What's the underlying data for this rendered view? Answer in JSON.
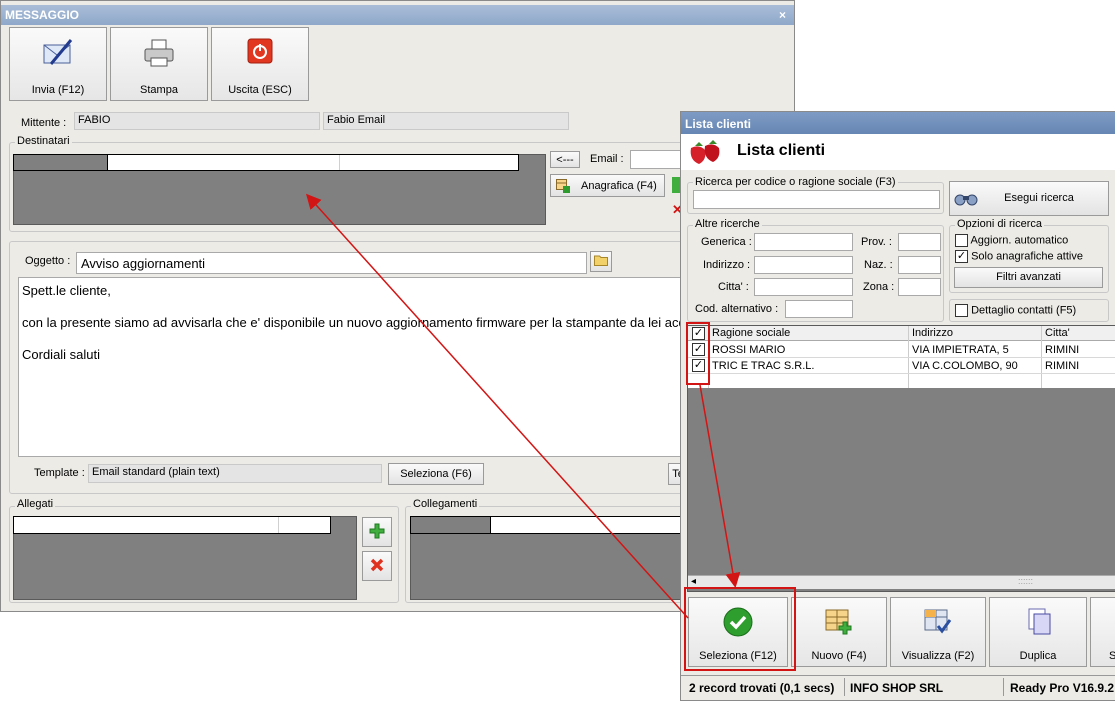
{
  "messaggio": {
    "title": "MESSAGGIO",
    "close": "×",
    "toolbar": {
      "invia": "Invia (F12)",
      "stampa": "Stampa",
      "uscita": "Uscita (ESC)"
    },
    "mittente_label": "Mittente :",
    "mittente_value": "FABIO",
    "mittente_email": "Fabio Email",
    "destinatari_label": "Destinatari",
    "arrow_btn": "<---",
    "email_label": "Email :",
    "anagrafica_btn": "Anagrafica (F4)",
    "oggetto_label": "Oggetto :",
    "oggetto_value": "Avviso aggiornamenti",
    "body_lines": [
      "Spett.le cliente,",
      "con la presente siamo ad avvisarla che e' disponibile un nuovo aggiornamento firmware per la stampante da lei acq",
      "Cordiali saluti"
    ],
    "template_label": "Template :",
    "template_value": "Email standard (plain text)",
    "seleziona_btn": "Seleziona (F6)",
    "te_btn": "Te",
    "allegati_label": "Allegati",
    "collegamenti_label": "Collegamenti"
  },
  "lista": {
    "window_title": "Lista clienti",
    "header_title": "Lista clienti",
    "ricerca_label": "Ricerca per codice o ragione sociale (F3)",
    "esegui_btn": "Esegui ricerca",
    "altre_label": "Altre ricerche",
    "generica": "Generica :",
    "prov": "Prov. :",
    "indirizzo": "Indirizzo :",
    "naz": "Naz. :",
    "citta": "Citta' :",
    "zona": "Zona :",
    "cod_alt": "Cod. alternativo :",
    "opzioni_label": "Opzioni di ricerca",
    "aggiorn": "Aggiorn. automatico",
    "solo": "Solo anagrafiche attive",
    "filtri_btn": "Filtri avanzati",
    "dettaglio": "Dettaglio contatti (F5)",
    "columns": [
      "Ragione sociale",
      "Indirizzo",
      "Citta'"
    ],
    "rows": [
      [
        "ROSSI MARIO",
        "VIA IMPIETRATA, 5",
        "RIMINI"
      ],
      [
        "TRIC E TRAC S.R.L.",
        "VIA C.COLOMBO, 90",
        "RIMINI"
      ]
    ],
    "bottom_buttons": {
      "seleziona": "Seleziona (F12)",
      "nuovo": "Nuovo (F4)",
      "visualizza": "Visualizza (F2)",
      "duplica": "Duplica",
      "s": "S"
    },
    "status": {
      "records": "2 record trovati (0,1 secs)",
      "company": "INFO SHOP SRL",
      "version": "Ready Pro V16.9.2"
    }
  },
  "colors": {
    "annotation": "#d31414",
    "title_bar": "#6686b3",
    "grid_grey": "#808080"
  }
}
